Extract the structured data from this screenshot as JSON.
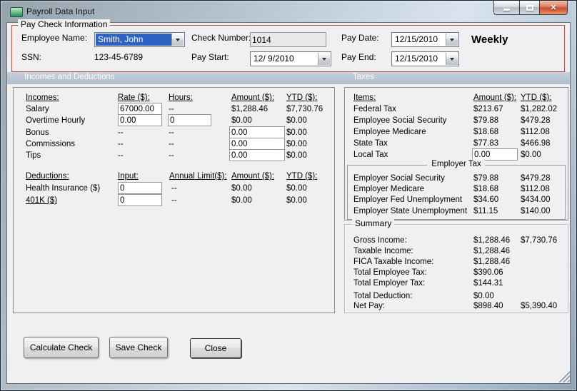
{
  "window": {
    "title": "Payroll Data Input",
    "close_glyph": "✕"
  },
  "paycheck": {
    "legend": "Pay Check Information",
    "employee_name_label": "Employee Name:",
    "employee_name_value": "Smith, John",
    "ssn_label": "SSN:",
    "ssn_value": "123-45-6789",
    "check_number_label": "Check Number:",
    "check_number_value": "1014",
    "pay_start_label": "Pay Start:",
    "pay_start_value": "12/ 9/2010",
    "pay_date_label": "Pay Date:",
    "pay_date_value": "12/15/2010",
    "pay_end_label": "Pay End:",
    "pay_end_value": "12/15/2010",
    "frequency": "Weekly"
  },
  "sections": {
    "incomes_header": "Incomes and Deductions",
    "taxes_header": "Taxes"
  },
  "incomes": {
    "headers": {
      "name": "Incomes:",
      "rate": "Rate ($):",
      "hours": "Hours:",
      "amount": "Amount ($):",
      "ytd": "YTD ($):"
    },
    "rows": [
      {
        "name": "Salary",
        "rate": "67000.00",
        "hours": "--",
        "amount": "$1,288.46",
        "ytd": "$7,730.76"
      },
      {
        "name": "Overtime Hourly",
        "rate": "0.00",
        "hours": "0",
        "amount": "$0.00",
        "ytd": "$0.00"
      },
      {
        "name": "Bonus",
        "rate": "--",
        "hours": "--",
        "amount": "0.00",
        "ytd": "$0.00"
      },
      {
        "name": "Commissions",
        "rate": "--",
        "hours": "--",
        "amount": "0.00",
        "ytd": "$0.00"
      },
      {
        "name": "Tips",
        "rate": "--",
        "hours": "--",
        "amount": "0.00",
        "ytd": "$0.00"
      }
    ]
  },
  "deductions": {
    "headers": {
      "name": "Deductions:",
      "input": "Input:",
      "limit": "Annual Limit($):",
      "amount": "Amount ($):",
      "ytd": "YTD ($):"
    },
    "rows": [
      {
        "name": "Health Insurance  ($)",
        "input": "0",
        "limit": "--",
        "amount": "$0.00",
        "ytd": "$0.00"
      },
      {
        "name": "401K  ($)",
        "input": "0",
        "limit": "--",
        "amount": "$0.00",
        "ytd": "$0.00"
      }
    ]
  },
  "taxes": {
    "headers": {
      "name": "Items:",
      "amount": "Amount ($):",
      "ytd": "YTD ($):"
    },
    "rows": [
      {
        "name": "Federal Tax",
        "amount": "$213.67",
        "ytd": "$1,282.02"
      },
      {
        "name": "Employee Social Security",
        "amount": "$79.88",
        "ytd": "$479.28"
      },
      {
        "name": "Employee Medicare",
        "amount": "$18.68",
        "ytd": "$112.08"
      },
      {
        "name": "State Tax",
        "amount": "$77.83",
        "ytd": "$466.98"
      },
      {
        "name": "Local Tax",
        "amount": "0.00",
        "ytd": "$0.00"
      }
    ],
    "employer_header": "Employer Tax",
    "employer_rows": [
      {
        "name": "Employer Social Security",
        "amount": "$79.88",
        "ytd": "$479.28"
      },
      {
        "name": "Employer Medicare",
        "amount": "$18.68",
        "ytd": "$112.08"
      },
      {
        "name": "Employer Fed Unemployment",
        "amount": "$34.60",
        "ytd": "$434.00"
      },
      {
        "name": "Employer State Unemployment",
        "amount": "$11.15",
        "ytd": "$140.00"
      }
    ]
  },
  "summary": {
    "legend": "Summary",
    "rows": [
      {
        "name": "Gross Income:",
        "amount": "$1,288.46",
        "ytd": "$7,730.76"
      },
      {
        "name": "Taxable Income:",
        "amount": "$1,288.46",
        "ytd": ""
      },
      {
        "name": "FICA Taxable Income:",
        "amount": "$1,288.46",
        "ytd": ""
      },
      {
        "name": "Total Employee Tax:",
        "amount": "$390.06",
        "ytd": ""
      },
      {
        "name": "Total Employer Tax:",
        "amount": "$144.31",
        "ytd": ""
      },
      {
        "name": "Total Deduction:",
        "amount": "$0.00",
        "ytd": ""
      },
      {
        "name": "Net Pay:",
        "amount": "$898.40",
        "ytd": "$5,390.40"
      }
    ]
  },
  "buttons": {
    "calculate": "Calculate Check",
    "save": "Save Check",
    "close": "Close"
  },
  "colors": {
    "group_border": "#b5524d",
    "section_bar": "#b7c3d1",
    "selection_blue": "#2e63c4",
    "close_button_red": "#c94e2c",
    "client_bg": "#f0f0f0"
  }
}
